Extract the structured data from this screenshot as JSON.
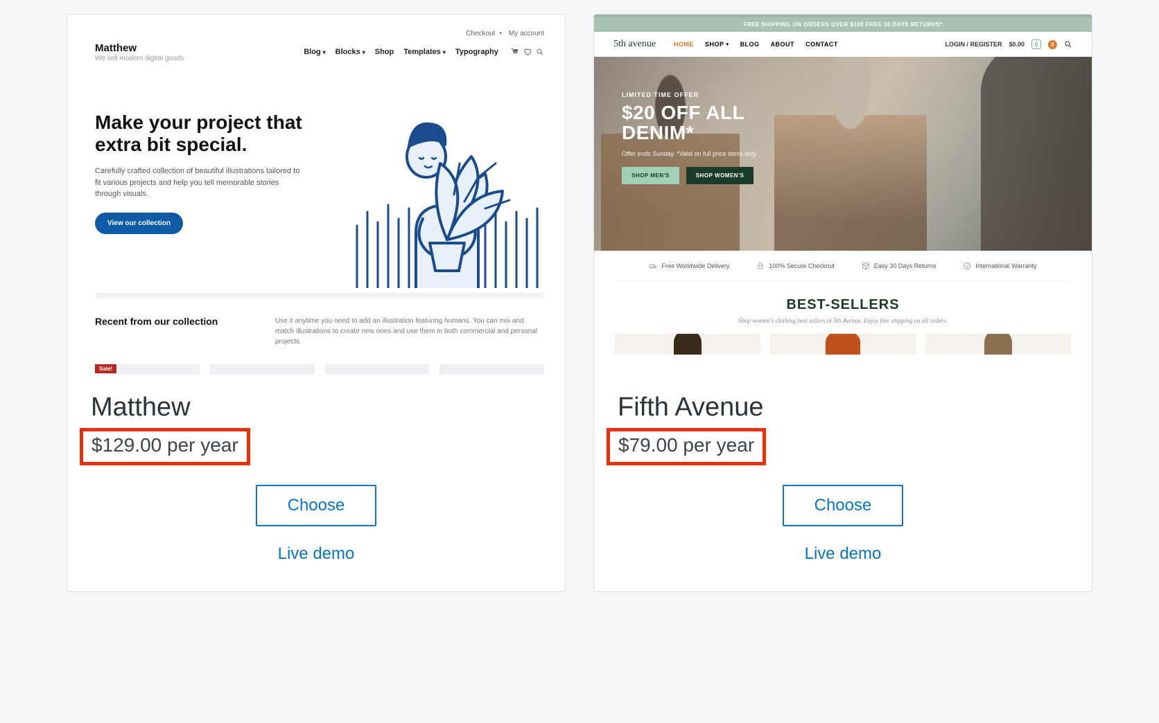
{
  "themes": [
    {
      "name": "Matthew",
      "price": "$129.00 per year",
      "choose_label": "Choose",
      "demo_label": "Live demo",
      "preview": {
        "top_links": {
          "checkout": "Checkout",
          "account": "My account"
        },
        "logo": {
          "title": "Matthew",
          "tagline": "We sell modern digital goods"
        },
        "nav": {
          "items": [
            "Blog",
            "Blocks",
            "Shop",
            "Templates",
            "Typography"
          ]
        },
        "hero": {
          "headline": "Make your project that extra bit special.",
          "sub": "Carefully crafted collection of beautiful illustrations tailored to fit various projects and help you tell memorable stories through visuals.",
          "cta": "View our collection"
        },
        "section": {
          "heading": "Recent from our collection",
          "desc": "Use it anytime you need to add an illustration featuring humans. You can mix and match illustrations to create new ones and use them in both commercial and personal projects."
        },
        "sale_badge": "Sale!"
      }
    },
    {
      "name": "Fifth Avenue",
      "price": "$79.00 per year",
      "choose_label": "Choose",
      "demo_label": "Live demo",
      "preview": {
        "top_banner": "FREE SHIPPING ON ORDERS OVER $100 FREE 30 DAYS RETURNS*",
        "brand": "5th avenue",
        "menu": {
          "home": "HOME",
          "shop": "SHOP",
          "blog": "BLOG",
          "about": "ABOUT",
          "contact": "CONTACT"
        },
        "right": {
          "login": "LOGIN / REGISTER",
          "amount": "$0.00",
          "cart_count": "0",
          "wish_count": "0"
        },
        "hero": {
          "limited": "LIMITED TIME OFFER",
          "headline1": "$20 OFF ALL",
          "headline2": "DENIM*",
          "offer": "Offer ends Sunday. *Valid on full price items only.",
          "btn_a": "SHOP MEN'S",
          "btn_b": "SHOP WOMEN'S"
        },
        "features": {
          "f1": "Free Worldwide Delivery",
          "f2": "100% Secure Checkout",
          "f3": "Easy 30 Days Returns",
          "f4": "International Warranty"
        },
        "best": {
          "title": "BEST-SELLERS",
          "sub": "Shop women's clothing best sellers at 5th Avenue. Enjoy free shipping on all orders."
        }
      }
    }
  ]
}
